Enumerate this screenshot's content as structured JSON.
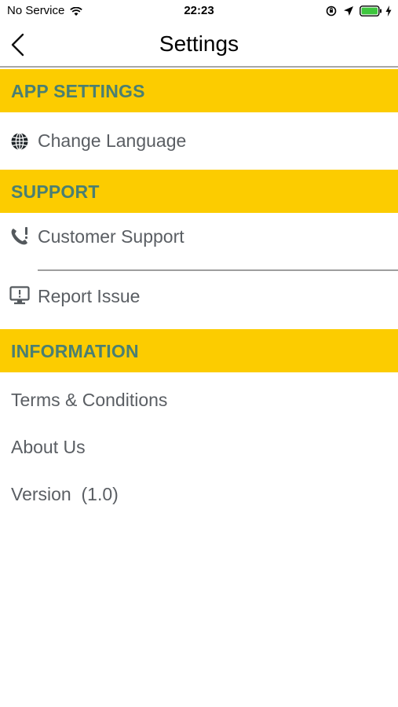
{
  "status_bar": {
    "carrier": "No Service",
    "time": "22:23"
  },
  "nav": {
    "title": "Settings",
    "back_icon": "chevron-left-icon"
  },
  "sections": [
    {
      "header": "APP SETTINGS",
      "items": [
        {
          "label": "Change Language",
          "icon": "globe-icon"
        }
      ]
    },
    {
      "header": "SUPPORT",
      "items": [
        {
          "label": "Customer Support",
          "icon": "phone-alert-icon"
        },
        {
          "label": "Report Issue",
          "icon": "monitor-alert-icon"
        }
      ]
    },
    {
      "header": "INFORMATION",
      "items": [
        {
          "label": "Terms & Conditions"
        },
        {
          "label": "About Us"
        },
        {
          "label": "Version  (1.0)"
        }
      ]
    }
  ],
  "colors": {
    "section_bg": "#fccc00",
    "section_text": "#4a7f72",
    "item_text": "#5a5e63"
  }
}
